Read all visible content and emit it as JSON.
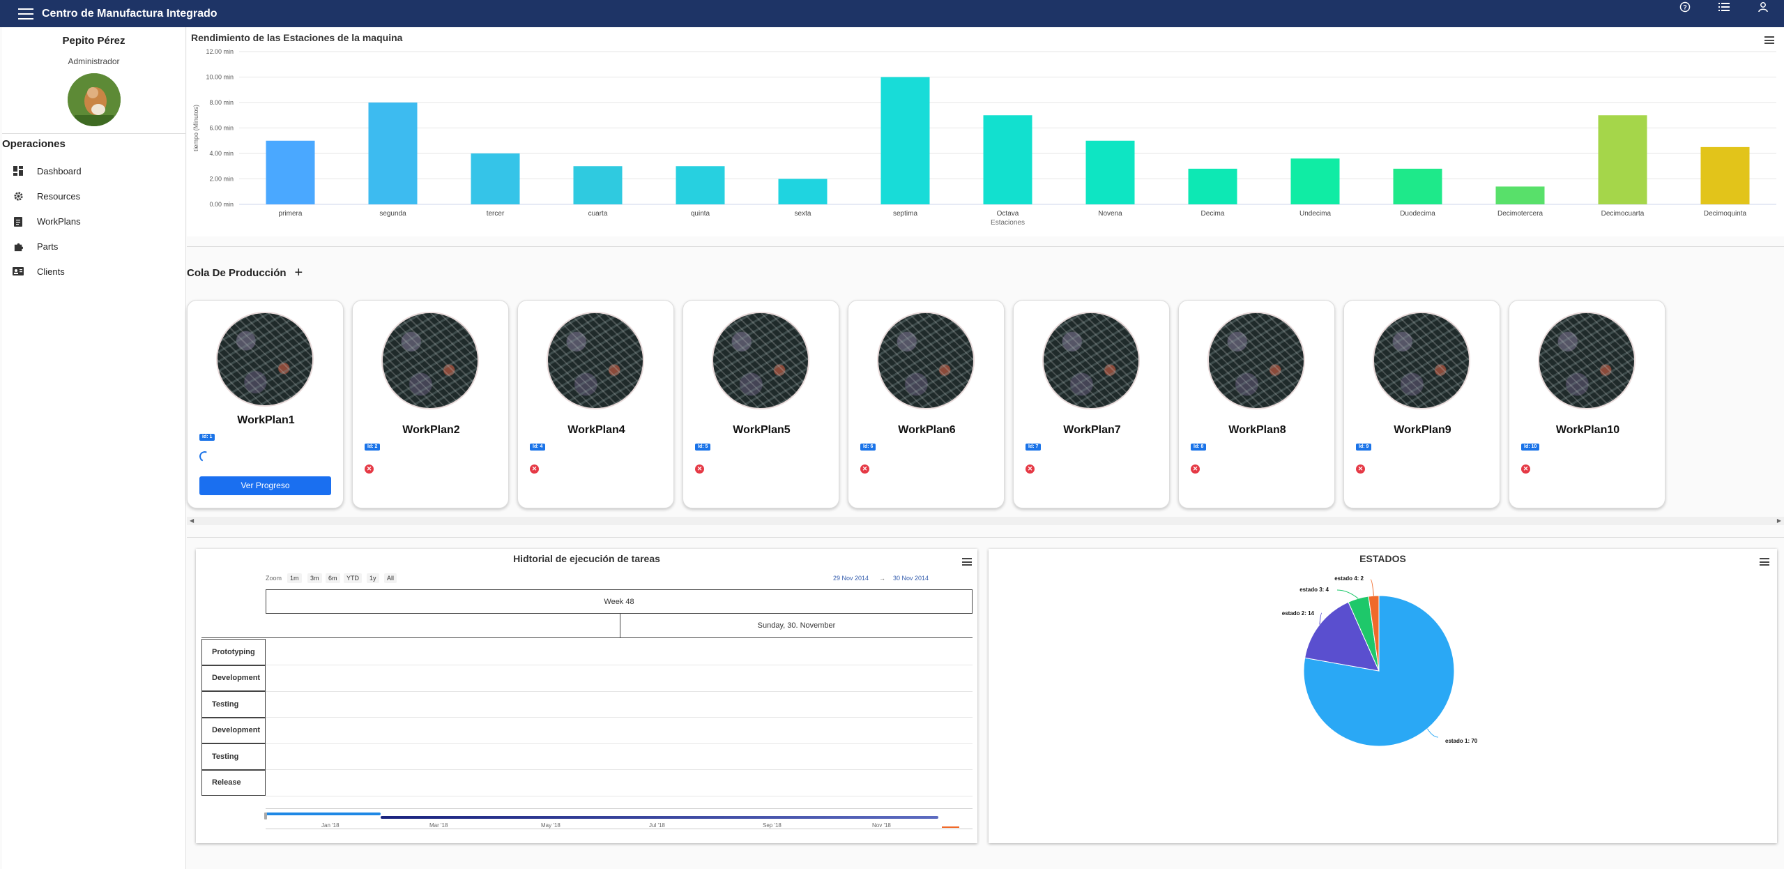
{
  "app": {
    "title": "Centro de Manufactura Integrado",
    "topbar_icons": [
      "help-circle-icon",
      "list-icon",
      "account-icon"
    ]
  },
  "user": {
    "name": "Pepito Pérez",
    "role": "Administrador"
  },
  "sidebar": {
    "section_title": "Operaciones",
    "items": [
      {
        "label": "Dashboard",
        "icon": "dashboard-icon"
      },
      {
        "label": "Resources",
        "icon": "gear-icon"
      },
      {
        "label": "WorkPlans",
        "icon": "clipboard-icon"
      },
      {
        "label": "Parts",
        "icon": "puzzle-icon"
      },
      {
        "label": "Clients",
        "icon": "contact-card-icon"
      }
    ]
  },
  "colors": {
    "topbar": "#1e3466",
    "primary_button": "#1a6ff0",
    "error": "#e53945"
  },
  "chart_data": [
    {
      "type": "bar",
      "title": "Rendimiento de las Estaciones de la maquina",
      "xlabel": "Estaciones",
      "ylabel": "tiempo (Minutos)",
      "ylim": [
        0,
        12
      ],
      "y_ticks": [
        "0.00 min",
        "2.00 min",
        "4.00 min",
        "6.00 min",
        "8.00 min",
        "10.00 min",
        "12.00 min"
      ],
      "categories": [
        "primera",
        "segunda",
        "tercer",
        "cuarta",
        "quinta",
        "sexta",
        "septima",
        "Octava",
        "Novena",
        "Decima",
        "Undecima",
        "Duodecima",
        "Decimotercera",
        "Decimocuarta",
        "Decimoquinta"
      ],
      "values": [
        5,
        8,
        4,
        3,
        3,
        2,
        10,
        7,
        5,
        2.8,
        3.6,
        2.8,
        1.4,
        7,
        4.5
      ],
      "colors": [
        "#4aa8ff",
        "#3dbbf0",
        "#35c4e8",
        "#2fcae0",
        "#27d0e0",
        "#1fd4e0",
        "#18dcd8",
        "#12e0cf",
        "#0ee5c3",
        "#0de8b4",
        "#10eca4",
        "#1ee98a",
        "#58e06a",
        "#a5d64a",
        "#e2c41a"
      ],
      "grid": true,
      "legend": "none"
    },
    {
      "type": "pie",
      "title": "ESTADOS",
      "slices": [
        {
          "label": "estado 1",
          "value": 70,
          "color": "#2aa8f5"
        },
        {
          "label": "estado 2",
          "value": 14,
          "color": "#5a4fcf"
        },
        {
          "label": "estado 3",
          "value": 4,
          "color": "#1ec86a"
        },
        {
          "label": "estado 4",
          "value": 2,
          "color": "#f06a2a"
        }
      ],
      "data_labels": [
        "estado 1: 70",
        "estado 2: 14",
        "estado 3: 4",
        "estado 4: 2"
      ]
    }
  ],
  "queue": {
    "title": "Cola De Producción",
    "add_icon": "plus-icon",
    "cards": [
      {
        "name": "WorkPlan1",
        "id": "Id: 1",
        "status": "loading",
        "button": "Ver Progreso"
      },
      {
        "name": "WorkPlan2",
        "id": "Id: 2",
        "status": "error"
      },
      {
        "name": "WorkPlan4",
        "id": "Id: 4",
        "status": "error"
      },
      {
        "name": "WorkPlan5",
        "id": "Id: 5",
        "status": "error"
      },
      {
        "name": "WorkPlan6",
        "id": "Id: 6",
        "status": "error"
      },
      {
        "name": "WorkPlan7",
        "id": "Id: 7",
        "status": "error"
      },
      {
        "name": "WorkPlan8",
        "id": "Id: 8",
        "status": "error"
      },
      {
        "name": "WorkPlan9",
        "id": "Id: 9",
        "status": "error"
      },
      {
        "name": "WorkPlan10",
        "id": "Id: 10",
        "status": "error"
      }
    ]
  },
  "gantt": {
    "title": "Hidtorial de ejecución de tareas",
    "zoom_label": "Zoom",
    "zoom_options": [
      "1m",
      "3m",
      "6m",
      "YTD",
      "1y",
      "All"
    ],
    "date_from": "29 Nov 2014",
    "date_arrow": "→",
    "date_to": "30 Nov 2014",
    "week_header": "Week 48",
    "day_header": "Sunday, 30. November",
    "rows": [
      "Prototyping",
      "Development",
      "Testing",
      "Development",
      "Testing",
      "Release"
    ],
    "navigator_labels": [
      "Jan '18",
      "Mar '18",
      "May '18",
      "Jul '18",
      "Sep '18",
      "Nov '18"
    ]
  }
}
